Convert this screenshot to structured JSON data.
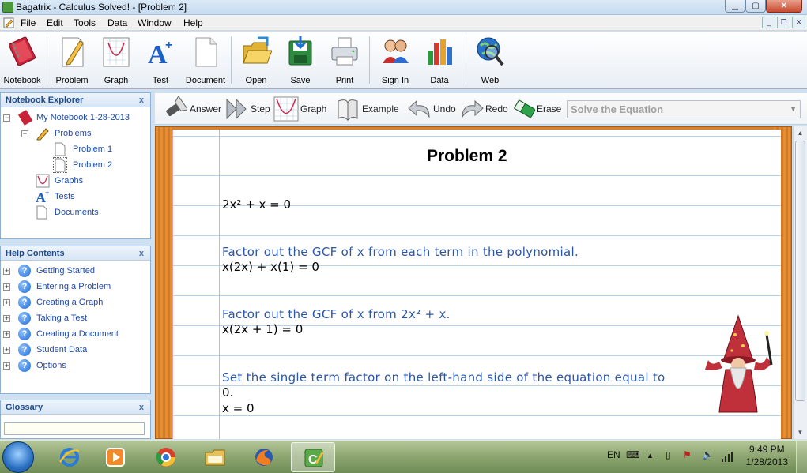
{
  "window": {
    "title": "Bagatrix - Calculus Solved! - [Problem 2]",
    "minimize": "▁",
    "maximize": "▢",
    "close": "✕"
  },
  "menu": {
    "items": [
      "File",
      "Edit",
      "Tools",
      "Data",
      "Window",
      "Help"
    ]
  },
  "mdi": {
    "minimize": "_",
    "restore": "❐",
    "close": "✕"
  },
  "toolbar": {
    "groups": [
      [
        {
          "label": "Notebook",
          "icon": "notebook-icon"
        }
      ],
      [
        {
          "label": "Problem",
          "icon": "pencil-icon"
        },
        {
          "label": "Graph",
          "icon": "graph-icon"
        },
        {
          "label": "Test",
          "icon": "test-icon"
        },
        {
          "label": "Document",
          "icon": "document-icon"
        }
      ],
      [
        {
          "label": "Open",
          "icon": "folder-icon"
        },
        {
          "label": "Save",
          "icon": "save-icon"
        },
        {
          "label": "Print",
          "icon": "printer-icon"
        }
      ],
      [
        {
          "label": "Sign In",
          "icon": "users-icon"
        },
        {
          "label": "Data",
          "icon": "bar-chart-icon"
        }
      ],
      [
        {
          "label": "Web",
          "icon": "globe-icon"
        }
      ]
    ]
  },
  "notebook_explorer": {
    "title": "Notebook Explorer",
    "close": "x",
    "notebook": "My Notebook 1-28-2013",
    "problems": "Problems",
    "problem_items": [
      "Problem 1",
      "Problem 2"
    ],
    "graphs": "Graphs",
    "tests": "Tests",
    "documents": "Documents"
  },
  "help_contents": {
    "title": "Help Contents",
    "close": "x",
    "items": [
      "Getting Started",
      "Entering a Problem",
      "Creating a Graph",
      "Taking a Test",
      "Creating a Document",
      "Student Data",
      "Options"
    ]
  },
  "glossary": {
    "title": "Glossary",
    "close": "x",
    "search_value": ""
  },
  "sub_toolbar": {
    "buttons": [
      {
        "label": "Answer",
        "icon": "flashlight-icon"
      },
      {
        "label": "Step",
        "icon": "step-arrows-icon"
      },
      {
        "label": "Graph",
        "icon": "graph-icon"
      },
      {
        "label": "Example",
        "icon": "book-icon"
      },
      {
        "label": "Undo",
        "icon": "undo-icon"
      },
      {
        "label": "Redo",
        "icon": "redo-icon"
      },
      {
        "label": "Erase",
        "icon": "eraser-icon"
      }
    ],
    "solve_select": "Solve the Equation"
  },
  "problem": {
    "title": "Problem 2",
    "equation": "2x² + x = 0",
    "steps": [
      {
        "text": "Factor out the GCF of x from each term in the polynomial.",
        "result": "x(2x) + x(1) = 0"
      },
      {
        "text": "Factor out the GCF of x from 2x² + x.",
        "result": "x(2x + 1) = 0"
      },
      {
        "text": "Set the single term factor on the left-hand side of the equation equal to",
        "text2": "0.",
        "result": "x = 0"
      }
    ]
  },
  "taskbar": {
    "apps": [
      "start-orb",
      "ie-icon",
      "media-player-icon",
      "chrome-icon",
      "explorer-icon",
      "firefox-icon",
      "bagatrix-icon"
    ],
    "language": "EN",
    "time": "9:49 PM",
    "date": "1/28/2013"
  },
  "colors": {
    "step_text": "#2a56a8",
    "panel_header": "#1f4a8a",
    "notebook_frame": "#d9822e",
    "margin_line": "#f0a9a9"
  }
}
